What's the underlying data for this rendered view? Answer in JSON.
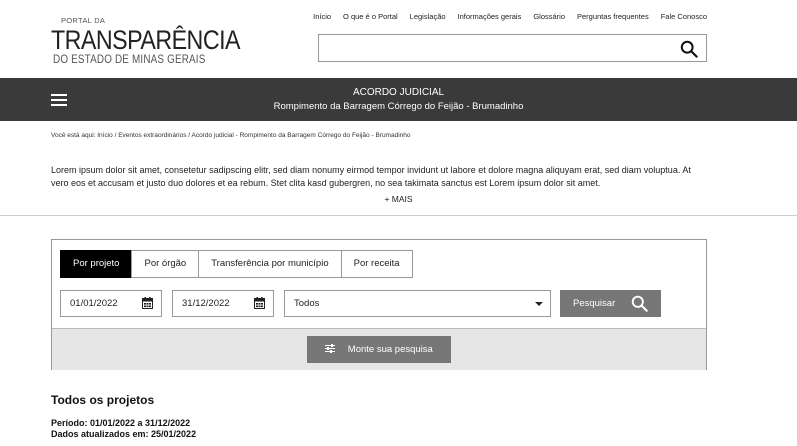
{
  "logo": {
    "small": "PORTAL DA",
    "big": "TRANSPARÊNCIA",
    "sub": "DO ESTADO DE MINAS GERAIS"
  },
  "topnav": {
    "items": [
      "Início",
      "O que é o Portal",
      "Legislação",
      "Informações gerais",
      "Glossário",
      "Perguntas frequentes",
      "Fale Conosco"
    ]
  },
  "search": {
    "value": "",
    "placeholder": ""
  },
  "banner": {
    "title": "ACORDO JUDICIAL",
    "subtitle": "Rompimento da Barragem Córrego do Feijão - Brumadinho"
  },
  "breadcrumb": "Você está aqui: Início / Eventos extraordinários / Acordo judicial - Rompimento da Barragem Córrego do Feijão - Brumadinho",
  "intro": {
    "text": "Lorem ipsum dolor sit amet, consetetur sadipscing elitr, sed diam nonumy eirmod tempor invidunt ut labore et dolore magna aliquyam erat, sed diam voluptua. At vero eos et accusam et justo duo dolores et ea rebum. Stet clita kasd gubergren, no sea takimata sanctus est Lorem ipsum dolor sit amet.",
    "more_label": "+ MAIS"
  },
  "filters": {
    "tabs": [
      "Por projeto",
      "Por órgão",
      "Transferência por município",
      "Por receita"
    ],
    "active_tab": 0,
    "date_start": "01/01/2022",
    "date_end": "31/12/2022",
    "select_value": "Todos",
    "search_label": "Pesquisar",
    "build_label": "Monte sua pesquisa"
  },
  "results": {
    "title": "Todos os projetos",
    "period": "Período: 01/01/2022 a 31/12/2022",
    "updated": "Dados atualizados em: 25/01/2022"
  }
}
